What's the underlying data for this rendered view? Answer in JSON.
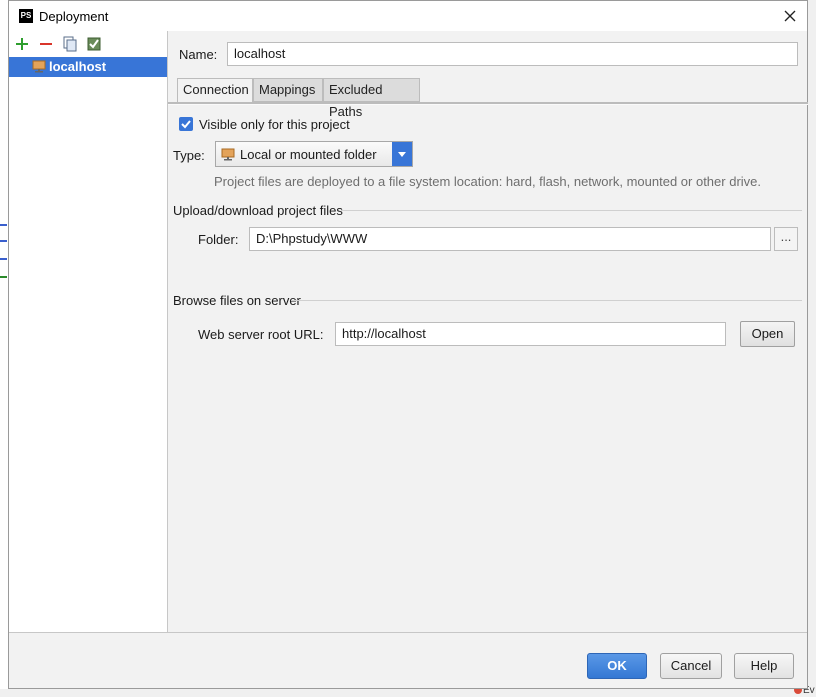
{
  "window": {
    "title": "Deployment",
    "app_icon_text": "PS"
  },
  "toolbar": {
    "add": "add-icon",
    "remove": "remove-icon",
    "copy": "copy-icon",
    "default": "set-default-icon"
  },
  "servers": [
    {
      "label": "localhost",
      "icon": "local-folder-server-icon"
    }
  ],
  "name": {
    "label": "Name:",
    "value": "localhost"
  },
  "tabs": [
    {
      "label": "Connection",
      "active": true
    },
    {
      "label": "Mappings",
      "active": false
    },
    {
      "label": "Excluded Paths",
      "active": false
    }
  ],
  "connection": {
    "visible_only": {
      "label": "Visible only for this project",
      "checked": true
    },
    "type": {
      "label": "Type:",
      "value": "Local or mounted folder"
    },
    "hint": "Project files are deployed to a file system location: hard, flash, network, mounted or other drive.",
    "upload_section": "Upload/download project files",
    "folder": {
      "label": "Folder:",
      "value": "D:\\Phpstudy\\WWW",
      "browse": "..."
    },
    "browse_section": "Browse files on server",
    "web_root": {
      "label": "Web server root URL:",
      "value": "http://localhost",
      "open": "Open"
    }
  },
  "buttons": {
    "ok": "OK",
    "cancel": "Cancel",
    "help": "Help"
  },
  "background": {
    "event_text": "Ev"
  },
  "colors": {
    "accent": "#3875d7",
    "add": "#2e9e2e",
    "remove": "#d9352b"
  }
}
